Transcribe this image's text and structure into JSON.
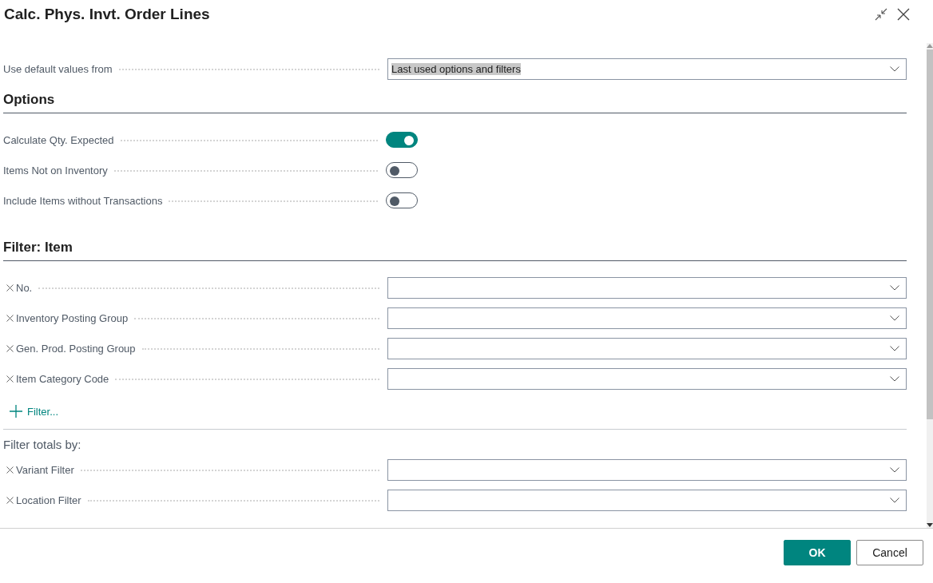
{
  "window": {
    "title": "Calc. Phys. Invt. Order Lines"
  },
  "default_values": {
    "label": "Use default values from",
    "value": "Last used options and filters",
    "text_selected": true
  },
  "options": {
    "heading": "Options",
    "items": [
      {
        "label": "Calculate Qty. Expected",
        "on": true
      },
      {
        "label": "Items Not on Inventory",
        "on": false
      },
      {
        "label": "Include Items without Transactions",
        "on": false
      }
    ]
  },
  "filter_item": {
    "heading": "Filter: Item",
    "fields": [
      {
        "label": "No."
      },
      {
        "label": "Inventory Posting Group"
      },
      {
        "label": "Gen. Prod. Posting Group"
      },
      {
        "label": "Item Category Code"
      }
    ],
    "add_filter": "Filter..."
  },
  "filter_totals": {
    "heading": "Filter totals by:",
    "fields": [
      {
        "label": "Variant Filter"
      },
      {
        "label": "Location Filter"
      }
    ]
  },
  "buttons": [
    {
      "label": "OK",
      "kind": "primary"
    },
    {
      "label": "Cancel",
      "kind": "secondary"
    }
  ]
}
